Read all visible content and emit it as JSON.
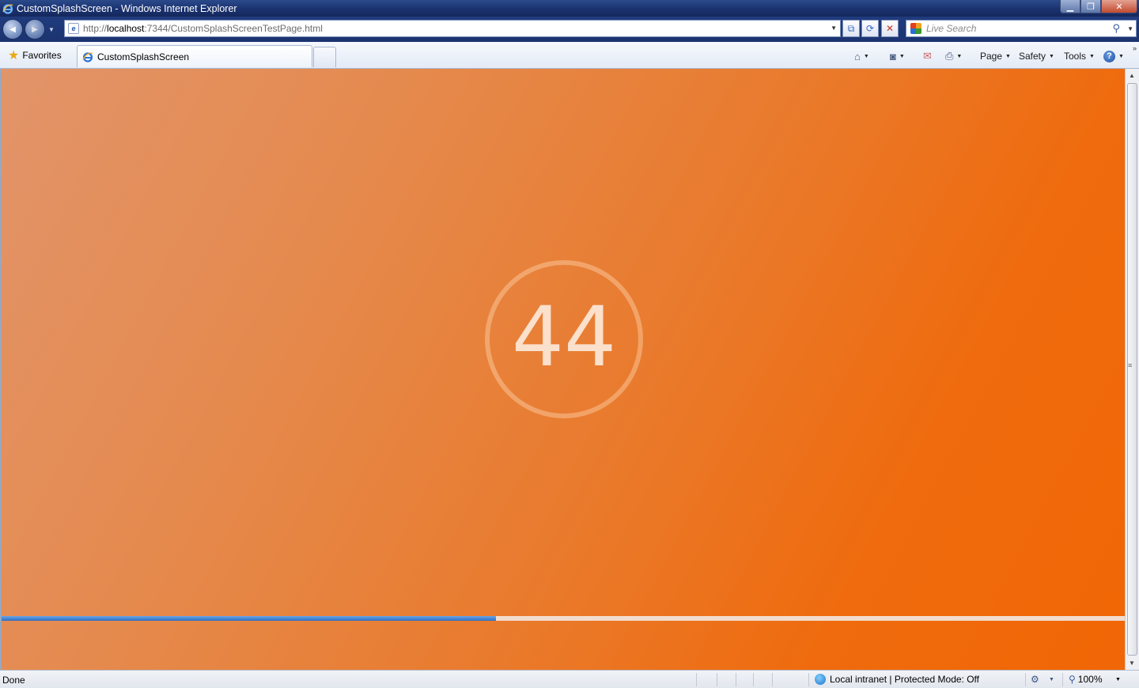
{
  "window": {
    "title": "CustomSplashScreen - Windows Internet Explorer",
    "minimize_label": "▁",
    "restore_label": "❐",
    "close_label": "✕"
  },
  "navbar": {
    "back_icon": "◀",
    "forward_icon": "▶",
    "url_prefix": "http://",
    "url_host": "localhost",
    "url_rest": ":7344/CustomSplashScreenTestPage.html",
    "search_placeholder": "Live Search"
  },
  "cmdbar": {
    "favorites_label": "Favorites",
    "tab_label": "CustomSplashScreen",
    "page_label": "Page",
    "safety_label": "Safety",
    "tools_label": "Tools",
    "help_label": "?"
  },
  "splash": {
    "counter": "44",
    "progress_percent": 44,
    "accent_color": "#2d6fc2",
    "background_colors": [
      "#e2946a",
      "#f16605"
    ]
  },
  "status": {
    "text": "Done",
    "zone": "Local intranet | Protected Mode: Off",
    "zoom": "100%"
  }
}
